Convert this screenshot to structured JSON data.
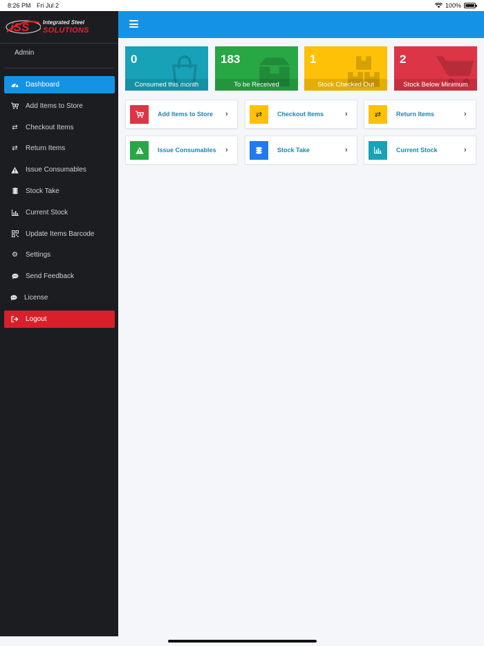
{
  "status_bar": {
    "time": "8:26 PM",
    "date": "Fri Jul 2",
    "battery": "100%"
  },
  "brand": {
    "line1": "Integrated Steel",
    "line2": "SOLUTIONS",
    "logo_text": "iSS"
  },
  "user": {
    "name": "Admin"
  },
  "sidebar": {
    "items": [
      {
        "label": "Dashboard",
        "icon": "dashboard-icon",
        "active": true
      },
      {
        "label": "Add Items to Store",
        "icon": "cart-plus-icon"
      },
      {
        "label": "Checkout Items",
        "icon": "exchange-icon"
      },
      {
        "label": "Return Items",
        "icon": "exchange-icon"
      },
      {
        "label": "Issue Consumables",
        "icon": "warning-icon"
      },
      {
        "label": "Stock Take",
        "icon": "coins-icon"
      },
      {
        "label": "Current Stock",
        "icon": "bar-chart-icon"
      },
      {
        "label": "Update Items Barcode",
        "icon": "qrcode-icon"
      },
      {
        "label": "Settings",
        "icon": "gear-icon"
      },
      {
        "label": "Send Feedback",
        "icon": "comment-icon"
      },
      {
        "label": "License",
        "icon": "comment-icon"
      },
      {
        "label": "Logout",
        "icon": "sign-out-icon"
      }
    ]
  },
  "stats": [
    {
      "value": "0",
      "label": "Consumed this month",
      "color": "#17a2b8",
      "icon": "shopping-bag-icon"
    },
    {
      "value": "183",
      "label": "To be Received",
      "color": "#28a745",
      "icon": "box-icon"
    },
    {
      "value": "1",
      "label": "Stock Checked Out",
      "color": "#ffc107",
      "icon": "boxes-icon"
    },
    {
      "value": "2",
      "label": "Stock Below Minimum",
      "color": "#dc3545",
      "icon": "cart-icon"
    }
  ],
  "tiles": [
    {
      "label": "Add Items to Store",
      "color": "#dc3545",
      "icon": "cart-plus-icon"
    },
    {
      "label": "Checkout Items",
      "color": "#ffc107",
      "icon": "exchange-icon"
    },
    {
      "label": "Return Items",
      "color": "#ffc107",
      "icon": "exchange-icon"
    },
    {
      "label": "Issue Consumables",
      "color": "#28a745",
      "icon": "warning-icon"
    },
    {
      "label": "Stock Take",
      "color": "#1e7bf0",
      "icon": "coins-icon"
    },
    {
      "label": "Current Stock",
      "color": "#17a2b8",
      "icon": "bar-chart-icon"
    }
  ],
  "colors": {
    "primary": "#1493e6",
    "sidebar_bg": "#1c1d21",
    "logout": "#d9202a",
    "link": "#1a87b8"
  }
}
